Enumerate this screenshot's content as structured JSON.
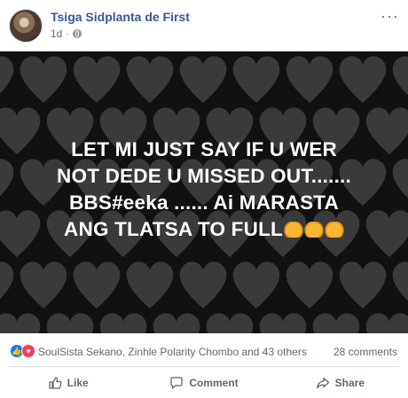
{
  "post": {
    "author": "Tsiga Sidplanta de First",
    "time": "1d",
    "separator": "·",
    "menu": "···",
    "image_text_lines": [
      "LET MI JUST SAY IF U WER",
      "NOT DEDE U MISSED OUT.......",
      "BBS#eeka ...... Ai MARASTA",
      "ANG TLATSA TO FULL"
    ],
    "image_background": "#111111",
    "heart_color": "#3a3a3a",
    "emoji_icon": "oncoming-fist-emoji"
  },
  "stats": {
    "reactions": [
      "like",
      "love"
    ],
    "reactors_text": "SoulSista Sekano, Zinhle Polarity Chombo and 43 others",
    "comments_text": "28 comments"
  },
  "actions": {
    "like_label": "Like",
    "comment_label": "Comment",
    "share_label": "Share"
  },
  "colors": {
    "link": "#385898",
    "muted": "#606770",
    "like_blue": "#1877f2",
    "love_red": "#f33e58"
  }
}
